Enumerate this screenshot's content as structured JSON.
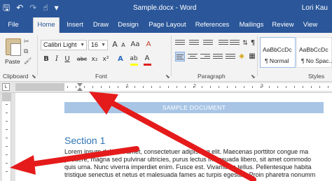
{
  "titlebar": {
    "title": "Sample.docx - Word",
    "user": "Lori Kau",
    "qat": [
      {
        "icon": "save-icon",
        "glyph": "🖫"
      },
      {
        "icon": "undo-icon",
        "glyph": "↶"
      },
      {
        "icon": "redo-icon",
        "glyph": "↷"
      },
      {
        "icon": "touch-mode-icon",
        "glyph": "☝"
      },
      {
        "icon": "customize-icon",
        "glyph": "▾"
      }
    ]
  },
  "tabs": [
    "File",
    "Home",
    "Insert",
    "Draw",
    "Design",
    "Page Layout",
    "References",
    "Mailings",
    "Review",
    "View"
  ],
  "ribbon": {
    "clipboard": {
      "paste_label": "Paste",
      "group_label": "Clipboard"
    },
    "font": {
      "font_name": "Calibri Light",
      "font_size": "16",
      "group_label": "Font",
      "grow": "A",
      "shrink": "A",
      "change_case": "Aa",
      "bold": "B",
      "italic": "I",
      "underline": "U",
      "strikethrough": "abc",
      "subscript": "x₂",
      "superscript": "x²",
      "text_effects": "A",
      "highlight": "ab",
      "font_color": "A",
      "highlight_color": "#ffff00",
      "font_color_value": "#e02020"
    },
    "paragraph": {
      "group_label": "Paragraph"
    },
    "styles": {
      "group_label": "Styles",
      "items": [
        {
          "sample": "AaBbCcDc",
          "name": "¶ Normal"
        },
        {
          "sample": "AaBbCcDc",
          "name": "¶ No Spac..."
        }
      ]
    }
  },
  "ruler": {
    "tab_selector": "L",
    "numbers": [
      "1",
      "2",
      "3"
    ]
  },
  "document": {
    "banner": "SAMPLE DOCUMENT",
    "heading": "Section 1",
    "lines": [
      "Lorem ipsum dolor sit amet, consectetuer adipiscing elit. Maecenas porttitor congue ma",
      "posuere, magna sed pulvinar ultricies, purus lectus malesuada libero, sit amet commodo",
      "quis urna. Nunc viverra imperdiet enim. Fusce est. Vivamus a tellus. Pellentesque habita",
      "tristique senectus et netus et malesuada fames ac turpis egestas. Proin pharetra nonumm"
    ]
  },
  "colors": {
    "word_blue": "#2b579a",
    "banner": "#a8c5e6",
    "heading": "#2e74b5",
    "arrow": "#e51b1b"
  }
}
